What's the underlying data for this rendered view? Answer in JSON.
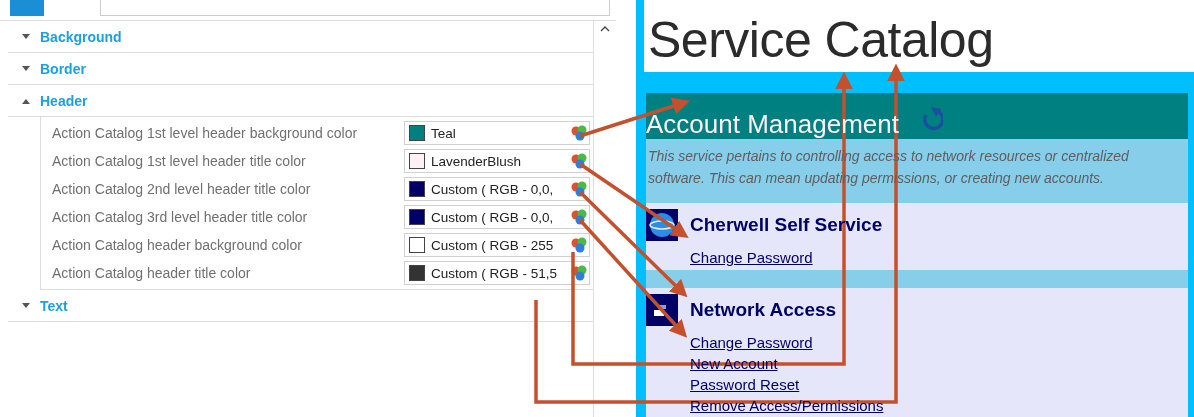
{
  "property_grid": {
    "categories": [
      {
        "label": "Background",
        "expanded": false
      },
      {
        "label": "Border",
        "expanded": false
      },
      {
        "label": "Header",
        "expanded": true,
        "properties": [
          {
            "name": "Action Catalog 1st level header background color",
            "value": "Teal",
            "color": "#008080"
          },
          {
            "name": "Action Catalog 1st level header title color",
            "value": "LavenderBlush",
            "color": "#fff0f5"
          },
          {
            "name": "Action Catalog 2nd level header title color",
            "value": "Custom ( RGB - 0,0,",
            "color": "#000066"
          },
          {
            "name": "Action Catalog 3rd level header title color",
            "value": "Custom ( RGB - 0,0,",
            "color": "#000066"
          },
          {
            "name": "Action Catalog header background color",
            "value": "Custom ( RGB - 255",
            "color": "#ffffff"
          },
          {
            "name": "Action Catalog header title color",
            "value": "Custom ( RGB - 51,5",
            "color": "#333333"
          }
        ]
      },
      {
        "label": "Text",
        "expanded": false
      }
    ]
  },
  "preview": {
    "title": "Service Catalog",
    "header": "Account Management",
    "description": "This service pertains to controlling access to network resources or centralized software. This can mean updating permissions, or creating new accounts.",
    "sections": [
      {
        "kind": "globe",
        "title": "Cherwell Self Service",
        "links": [
          "Change Password"
        ]
      },
      {
        "kind": "network",
        "title": "Network Access",
        "links": [
          "Change Password",
          "New Account",
          "Password Reset",
          "Remove Access/Permissions"
        ]
      }
    ]
  }
}
